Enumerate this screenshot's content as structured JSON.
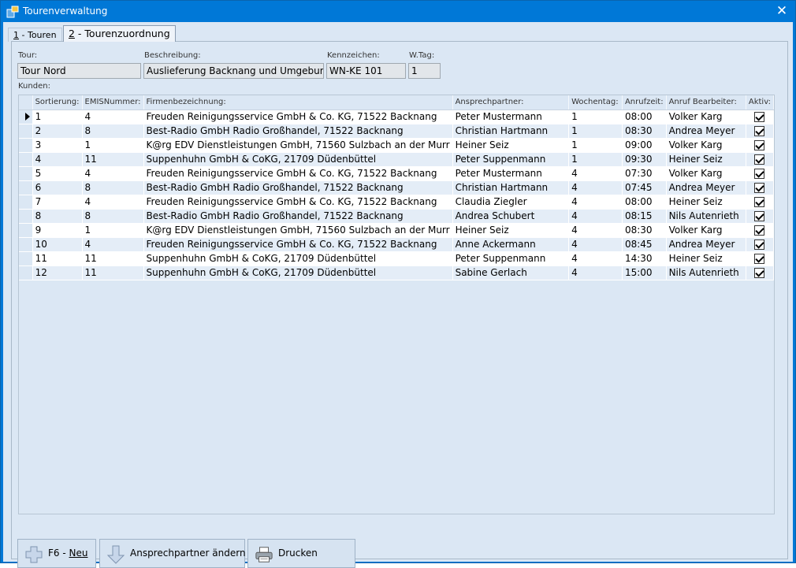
{
  "window": {
    "title": "Tourenverwaltung",
    "close_label": "✕"
  },
  "tabs": [
    {
      "num": "1",
      "rest": " - Touren"
    },
    {
      "num": "2",
      "rest": " - Tourenzuordnung"
    }
  ],
  "form": {
    "tour_label": "Tour:",
    "tour_value": "Tour Nord",
    "desc_label": "Beschreibung:",
    "desc_value": "Auslieferung Backnang und Umgebung",
    "plate_label": "Kennzeichen:",
    "plate_value": "WN-KE 101",
    "wtag_label": "W.Tag:",
    "wtag_value": "1",
    "kunden_label": "Kunden:"
  },
  "grid": {
    "columns": [
      "Sortierung:",
      "EMISNummer:",
      "Firmenbezeichnung:",
      "Ansprechpartner:",
      "Wochentag:",
      "Anrufzeit:",
      "Anruf Bearbeiter:",
      "Aktiv:"
    ],
    "rows": [
      [
        "1",
        "4",
        "Freuden Reinigungsservice GmbH & Co. KG, 71522 Backnang",
        "Peter Mustermann",
        "1",
        "08:00",
        "Volker Karg"
      ],
      [
        "2",
        "8",
        "Best-Radio GmbH Radio Großhandel, 71522 Backnang",
        "Christian Hartmann",
        "1",
        "08:30",
        "Andrea Meyer"
      ],
      [
        "3",
        "1",
        "K@rg EDV Dienstleistungen GmbH, 71560 Sulzbach an der Murr",
        "Heiner Seiz",
        "1",
        "09:00",
        "Volker Karg"
      ],
      [
        "4",
        "11",
        "Suppenhuhn GmbH & CoKG, 21709 Düdenbüttel",
        "Peter Suppenmann",
        "1",
        "09:30",
        "Heiner Seiz"
      ],
      [
        "5",
        "4",
        "Freuden Reinigungsservice GmbH & Co. KG, 71522 Backnang",
        "Peter Mustermann",
        "4",
        "07:30",
        "Volker Karg"
      ],
      [
        "6",
        "8",
        "Best-Radio GmbH Radio Großhandel, 71522 Backnang",
        "Christian Hartmann",
        "4",
        "07:45",
        "Andrea Meyer"
      ],
      [
        "7",
        "4",
        "Freuden Reinigungsservice GmbH & Co. KG, 71522 Backnang",
        "Claudia Ziegler",
        "4",
        "08:00",
        "Heiner Seiz"
      ],
      [
        "8",
        "8",
        "Best-Radio GmbH Radio Großhandel, 71522 Backnang",
        "Andrea Schubert",
        "4",
        "08:15",
        "Nils Autenrieth"
      ],
      [
        "9",
        "1",
        "K@rg EDV Dienstleistungen GmbH, 71560 Sulzbach an der Murr",
        "Heiner Seiz",
        "4",
        "08:30",
        "Volker Karg"
      ],
      [
        "10",
        "4",
        "Freuden Reinigungsservice GmbH & Co. KG, 71522 Backnang",
        "Anne Ackermann",
        "4",
        "08:45",
        "Andrea Meyer"
      ],
      [
        "11",
        "11",
        "Suppenhuhn GmbH & CoKG, 21709 Düdenbüttel",
        "Peter Suppenmann",
        "4",
        "14:30",
        "Heiner Seiz"
      ],
      [
        "12",
        "11",
        "Suppenhuhn GmbH & CoKG, 21709 Düdenbüttel",
        "Sabine Gerlach",
        "4",
        "15:00",
        "Nils Autenrieth"
      ]
    ]
  },
  "buttons": {
    "new_prefix": "F6 - ",
    "new_label": "Neu",
    "contact_label": "Ansprechpartner ändern",
    "print_label": "Drucken"
  },
  "icons": {
    "app": "app-icon",
    "close": "close-icon",
    "row_pointer": "row-pointer-icon",
    "checkbox": "checkbox-checked-icon",
    "new": "plus-icon",
    "contact": "arrow-down-icon",
    "print": "printer-icon"
  },
  "colors": {
    "titlebar": "#0078d7",
    "background": "#dbe7f4",
    "row_alt": "#e4edf7"
  }
}
